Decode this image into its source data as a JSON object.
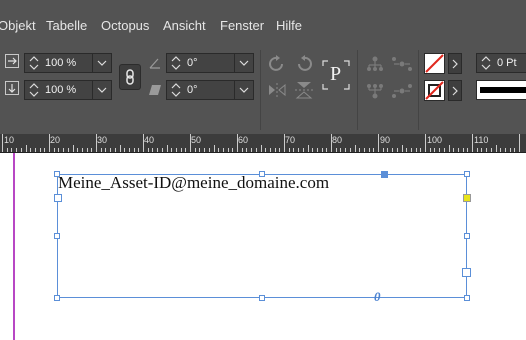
{
  "menu": {
    "items": [
      "Objekt",
      "Tabelle",
      "Octopus",
      "Ansicht",
      "Fenster",
      "Hilfe"
    ]
  },
  "control": {
    "scale_x": "100 %",
    "scale_y": "100 %",
    "rotate": "0°",
    "shear": "0°",
    "stroke_weight": "0 Pt",
    "paragraph_glyph": "P"
  },
  "ruler": {
    "labels": [
      "10",
      "20",
      "30",
      "40",
      "50",
      "60",
      "70",
      "80",
      "90",
      "100",
      "110"
    ]
  },
  "document": {
    "text": "Meine_Asset-ID@meine_domaine.com",
    "overset_marker": "0"
  },
  "colors": {
    "ui_dark": "#535353",
    "selection": "#5b8fd8",
    "margin_guide": "#b847c4",
    "anchor_yellow": "#e7e41c"
  },
  "icons": {
    "chain": "chain-link-icon",
    "rotate_cw": "rotate-clockwise-icon",
    "rotate_ccw": "rotate-counterclockwise-icon",
    "flip_h": "flip-horizontal-icon",
    "flip_v": "flip-vertical-icon"
  }
}
